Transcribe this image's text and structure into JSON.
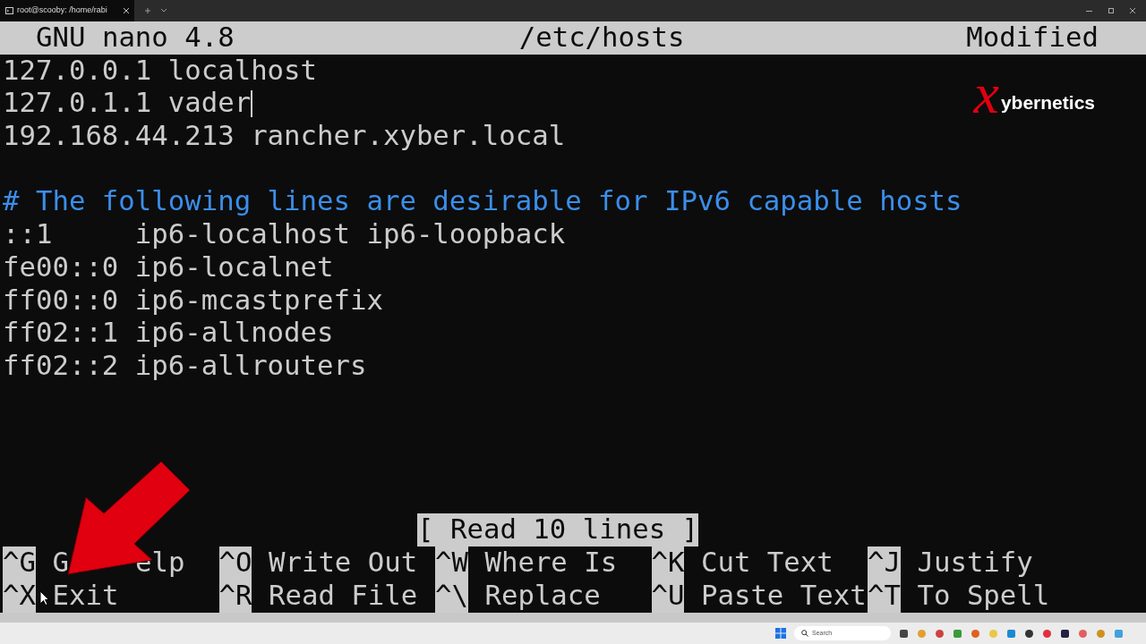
{
  "window": {
    "tab_title": "root@scooby: /home/rabi"
  },
  "nano": {
    "version": "GNU nano 4.8",
    "file": "/etc/hosts",
    "state": "Modified"
  },
  "lines": [
    {
      "kind": "text",
      "text": "127.0.0.1 localhost",
      "cursor": false
    },
    {
      "kind": "text",
      "text": "127.0.1.1 vader",
      "cursor": true
    },
    {
      "kind": "text",
      "text": "192.168.44.213 rancher.xyber.local",
      "cursor": false
    },
    {
      "kind": "blank"
    },
    {
      "kind": "comment",
      "text": "# The following lines are desirable for IPv6 capable hosts",
      "cursor": false
    },
    {
      "kind": "text",
      "text": "::1     ip6-localhost ip6-loopback",
      "cursor": false
    },
    {
      "kind": "text",
      "text": "fe00::0 ip6-localnet",
      "cursor": false
    },
    {
      "kind": "text",
      "text": "ff00::0 ip6-mcastprefix",
      "cursor": false
    },
    {
      "kind": "text",
      "text": "ff02::1 ip6-allnodes",
      "cursor": false
    },
    {
      "kind": "text",
      "text": "ff02::2 ip6-allrouters",
      "cursor": false
    }
  ],
  "status": "[ Read 10 lines ]",
  "shortcuts": [
    [
      {
        "key": "^G",
        "label": "G",
        "label_tail": "elp"
      },
      {
        "key": "^O",
        "label": "Write Out"
      },
      {
        "key": "^W",
        "label": "Where Is"
      },
      {
        "key": "^K",
        "label": "Cut Text"
      },
      {
        "key": "^J",
        "label": "Justify"
      }
    ],
    [
      {
        "key": "^X",
        "label": "Exit"
      },
      {
        "key": "^R",
        "label": "Read File"
      },
      {
        "key": "^\\",
        "label": "Replace"
      },
      {
        "key": "^U",
        "label": "Paste Text"
      },
      {
        "key": "^T",
        "label": "To Spell"
      }
    ]
  ],
  "logo": {
    "mark": "x",
    "text": "ybernetics"
  },
  "taskbar": {
    "search_placeholder": "Search"
  }
}
